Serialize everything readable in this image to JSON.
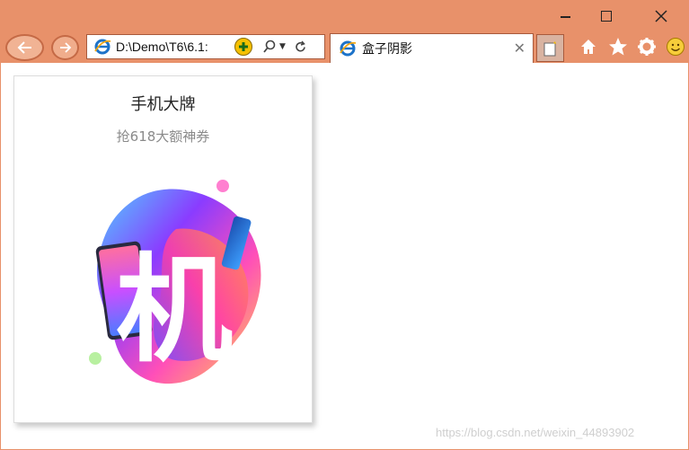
{
  "window": {
    "controls": {
      "minimize": "minimize",
      "maximize": "maximize",
      "close": "close"
    }
  },
  "toolbar": {
    "address": "D:\\Demo\\T6\\6.1:",
    "tab_title": "盒子阴影",
    "icons": [
      "back-icon",
      "forward-icon",
      "ie-icon",
      "compat-icon",
      "search-icon",
      "refresh-icon",
      "home-icon",
      "star-icon",
      "gear-icon",
      "smile-icon"
    ]
  },
  "card": {
    "title": "手机大牌",
    "subtitle": "抢618大额神券",
    "art_text": "机"
  },
  "watermark": "https://blog.csdn.net/weixin_44893902",
  "colors": {
    "chrome": "#e8916a",
    "shadow": "rgba(0,0,0,0.22)"
  }
}
